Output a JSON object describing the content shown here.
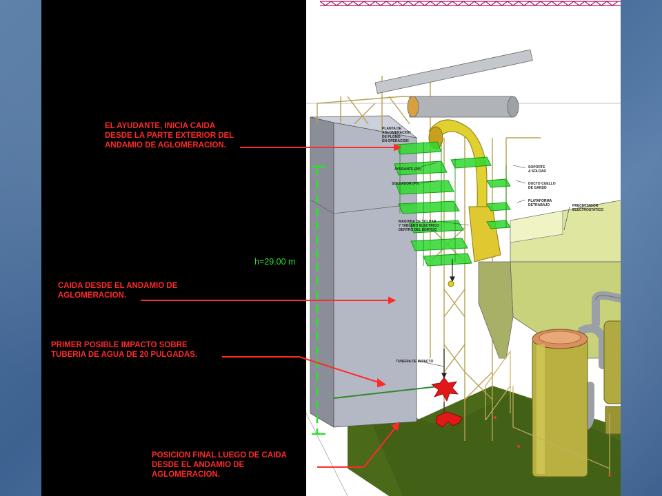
{
  "callouts": {
    "helper_fall": "EL AYUDANTE, INICIA CAIDA\nDESDE LA PARTE EXTERIOR DEL\nANDAMIO DE AGLOMERACION.",
    "fall_from_scaffold": "CAIDA DESDE EL ANDAMIO DE\nAGLOMERACION.",
    "first_impact": "PRIMER POSIBLE IMPACTO SOBRE\nTUBERIA DE AGUA DE 20 PULGADAS.",
    "final_position": "POSICION FINAL LUEGO DE CAIDA\nDESDE EL ANDAMIO DE\nAGLOMERACION."
  },
  "height_label": "h=29.00 m",
  "diagram_labels": {
    "plant_l1": "PLANTA DE",
    "plant_l2": "AGLOMERACION",
    "plant_l3": "DE PLOMO",
    "plant_l4": "EN OPERACION",
    "helper": "AYUDANTE (RP)",
    "welder": "SOLDADOR (PV)",
    "machine_l1": "MAQUINA DE SOLDAR",
    "machine_l2": "Y TABLERO ELECTRICO",
    "machine_l3": "DENTRO DEL EDIFICIO",
    "support_l1": "SOPORTE",
    "support_l2": "A SOLDAR",
    "duct_l1": "DUCTO CUELLO",
    "duct_l2": "DE GANSO",
    "platform_l1": "PLATAFORMA",
    "platform_l2": "DETRABAJO",
    "precip_l1": "PRECIPITADOR",
    "precip_l2": "ELECTROSTATICO",
    "pipe": "TUBERIA DE IMPACTO"
  },
  "colors": {
    "callout_red": "#ff2a2a",
    "height_green": "#2ee02e",
    "scaffold_green": "#2ed82e",
    "building_gray": "#b4b8c4",
    "precipitator_green": "#c8d27a",
    "vessel_olive": "#b8b040",
    "duct_yellow": "#e0d030",
    "ground_green": "#4a6a1a"
  }
}
